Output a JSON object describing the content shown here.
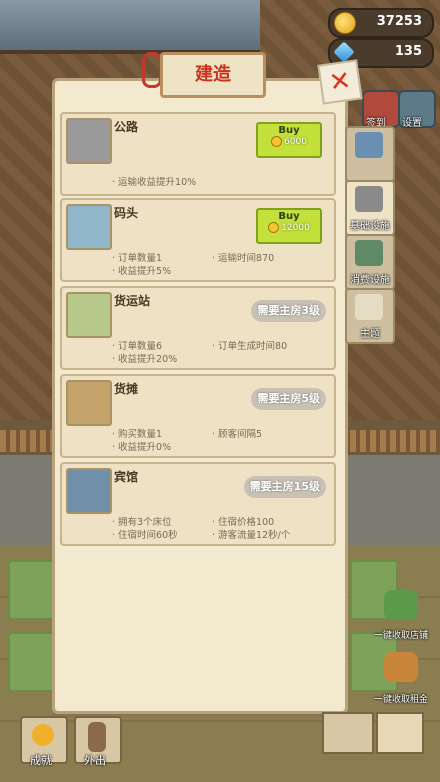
{
  "resources": {
    "coins": "37253",
    "gems": "135"
  },
  "side_icons": [
    {
      "label": "签到",
      "icon": "calendar-icon"
    },
    {
      "label": "设置",
      "icon": "gear-icon"
    }
  ],
  "panel": {
    "title": "建造",
    "close": "✕"
  },
  "tabs": [
    {
      "label": "",
      "icon": "staff-icon"
    },
    {
      "label": "基础设施",
      "icon": "infrastructure-icon"
    },
    {
      "label": "消费设施",
      "icon": "consumer-facility-icon"
    },
    {
      "label": "主题",
      "icon": "fence-theme-icon"
    }
  ],
  "cards": [
    {
      "name": "公路",
      "buy": {
        "label": "Buy",
        "price": "6000"
      },
      "stats": [
        "运输收益提升10%"
      ]
    },
    {
      "name": "码头",
      "buy": {
        "label": "Buy",
        "price": "12000"
      },
      "stats": [
        "订单数量1",
        "运输时间870",
        "收益提升5%"
      ]
    },
    {
      "name": "货运站",
      "locked": "需要主房3级",
      "stats": [
        "订单数量6",
        "订单生成时间80",
        "收益提升20%"
      ]
    },
    {
      "name": "货摊",
      "locked": "需要主房5级",
      "stats": [
        "购买数量1",
        "顾客间隔5",
        "收益提升0%"
      ]
    },
    {
      "name": "宾馆",
      "locked": "需要主房15级",
      "stats": [
        "拥有3个床位",
        "住宿价格100",
        "住宿时间60秒",
        "游客流量12秒/个"
      ]
    }
  ],
  "bottom": {
    "achievements": "成就",
    "go_out": "外出",
    "collect_shop": "一键收取店铺",
    "collect_rent": "一键收取租金"
  },
  "colors": {
    "title": "#c9331f",
    "buy": "#c4e03a",
    "locked": "#c9c2b4"
  }
}
